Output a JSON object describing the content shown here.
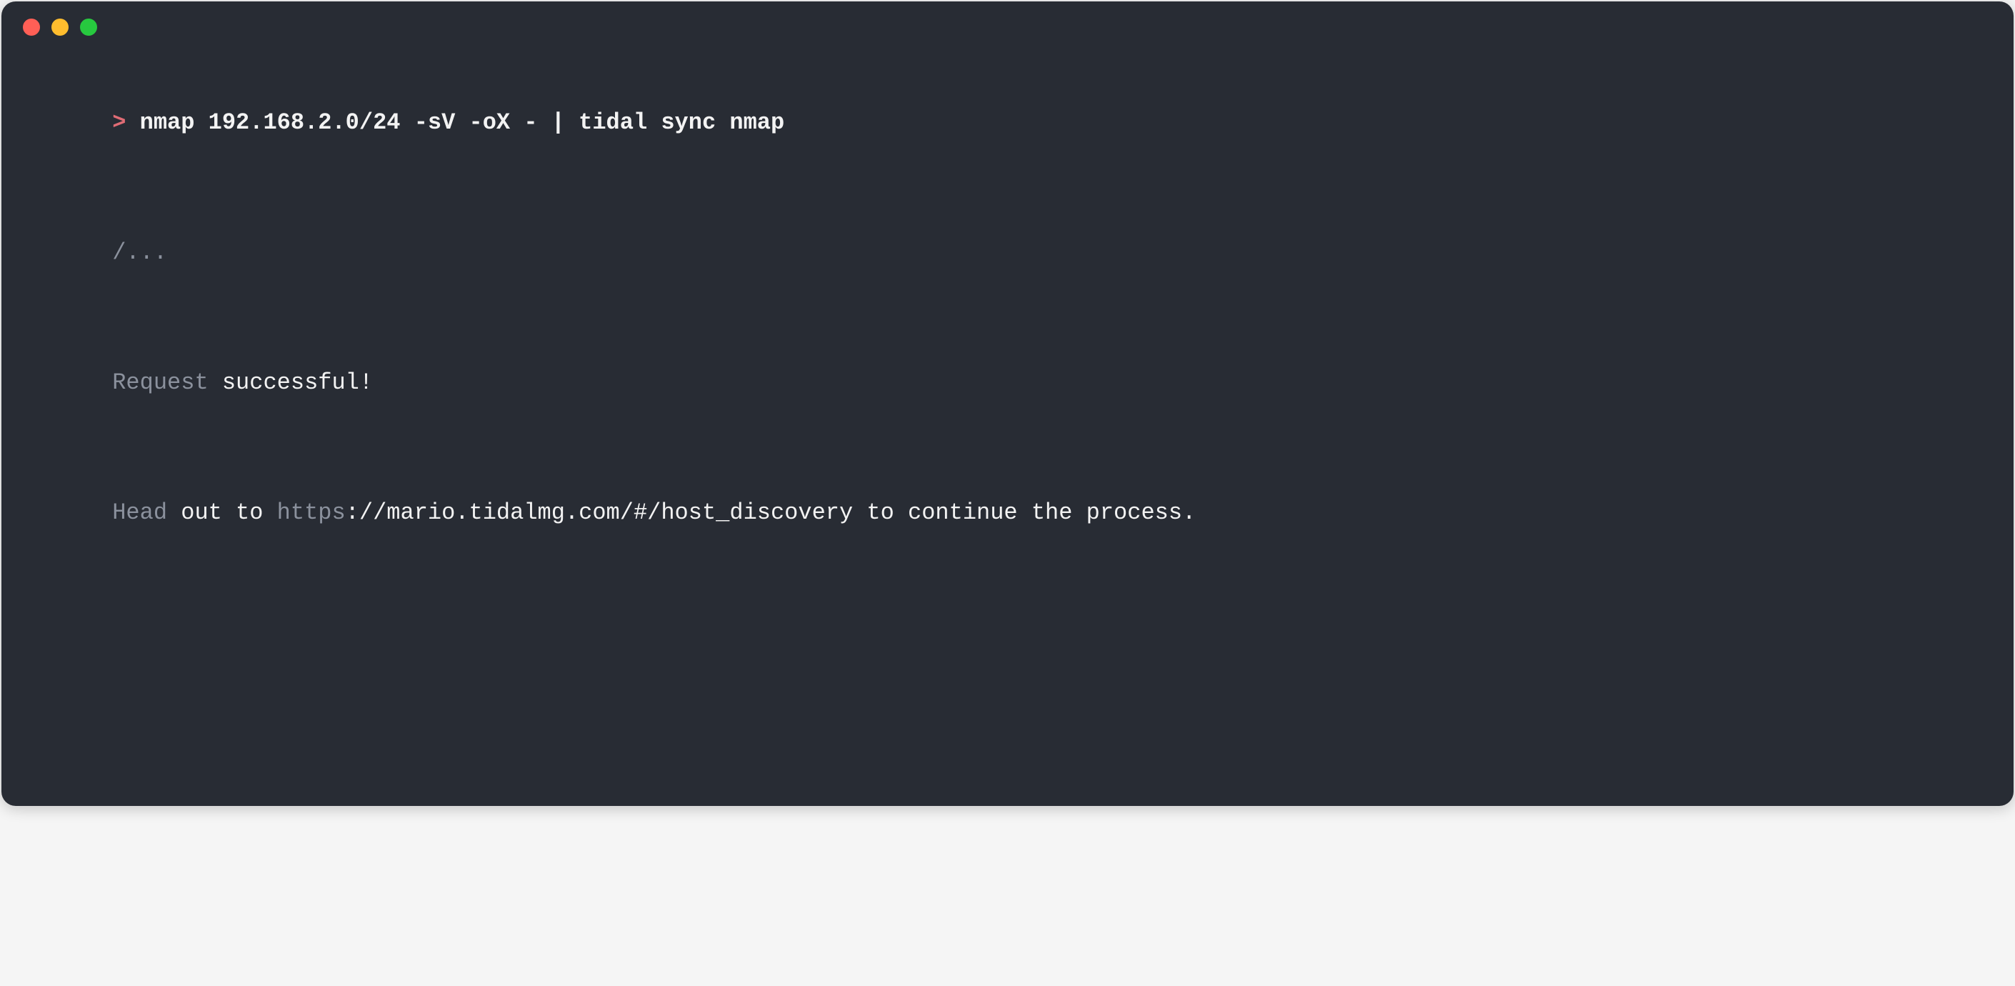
{
  "prompt": {
    "symbol": ">",
    "command": "nmap 192.168.2.0/24 -sV -oX - | tidal sync nmap"
  },
  "output": {
    "ellipsis": "/...",
    "status_word": "Request",
    "status_rest": " successful!",
    "follow_head": "Head",
    "follow_mid1": " out to ",
    "follow_scheme": "https",
    "follow_url_rest": "://mario.tidalmg.com/#/host_discovery to continue the process."
  }
}
